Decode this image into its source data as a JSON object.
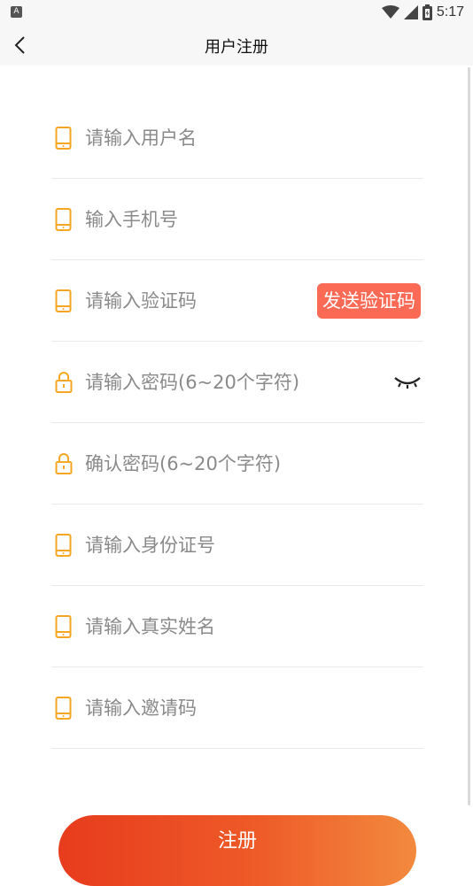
{
  "status_bar": {
    "indicator": "A",
    "time": "5:17",
    "icons": [
      "wifi-icon",
      "signal-icon",
      "battery-icon"
    ]
  },
  "navbar": {
    "title": "用户注册",
    "back_icon": "chevron-left-icon"
  },
  "form": {
    "username": {
      "placeholder": "请输入用户名",
      "value": "",
      "icon": "phone-icon"
    },
    "phone": {
      "placeholder": "输入手机号",
      "value": "",
      "icon": "phone-icon"
    },
    "verify_code": {
      "placeholder": "请输入验证码",
      "value": "",
      "icon": "phone-icon",
      "button_label": "发送验证码"
    },
    "password": {
      "placeholder": "请输入密码(6~20个字符)",
      "value": "",
      "icon": "lock-icon",
      "toggle_icon": "eye-closed-icon"
    },
    "confirm_password": {
      "placeholder": "确认密码(6~20个字符)",
      "value": "",
      "icon": "lock-icon"
    },
    "id_card": {
      "placeholder": "请输入身份证号",
      "value": "",
      "icon": "phone-icon"
    },
    "real_name": {
      "placeholder": "请输入真实姓名",
      "value": "",
      "icon": "phone-icon"
    },
    "invite_code": {
      "placeholder": "请输入邀请码",
      "value": "",
      "icon": "phone-icon"
    }
  },
  "register_button": {
    "label": "注册"
  },
  "colors": {
    "accent_icon": "#f5a623",
    "send_code_bg": "#fb6a55",
    "register_gradient_start": "#e73c1d",
    "register_gradient_end": "#f28a3e"
  }
}
